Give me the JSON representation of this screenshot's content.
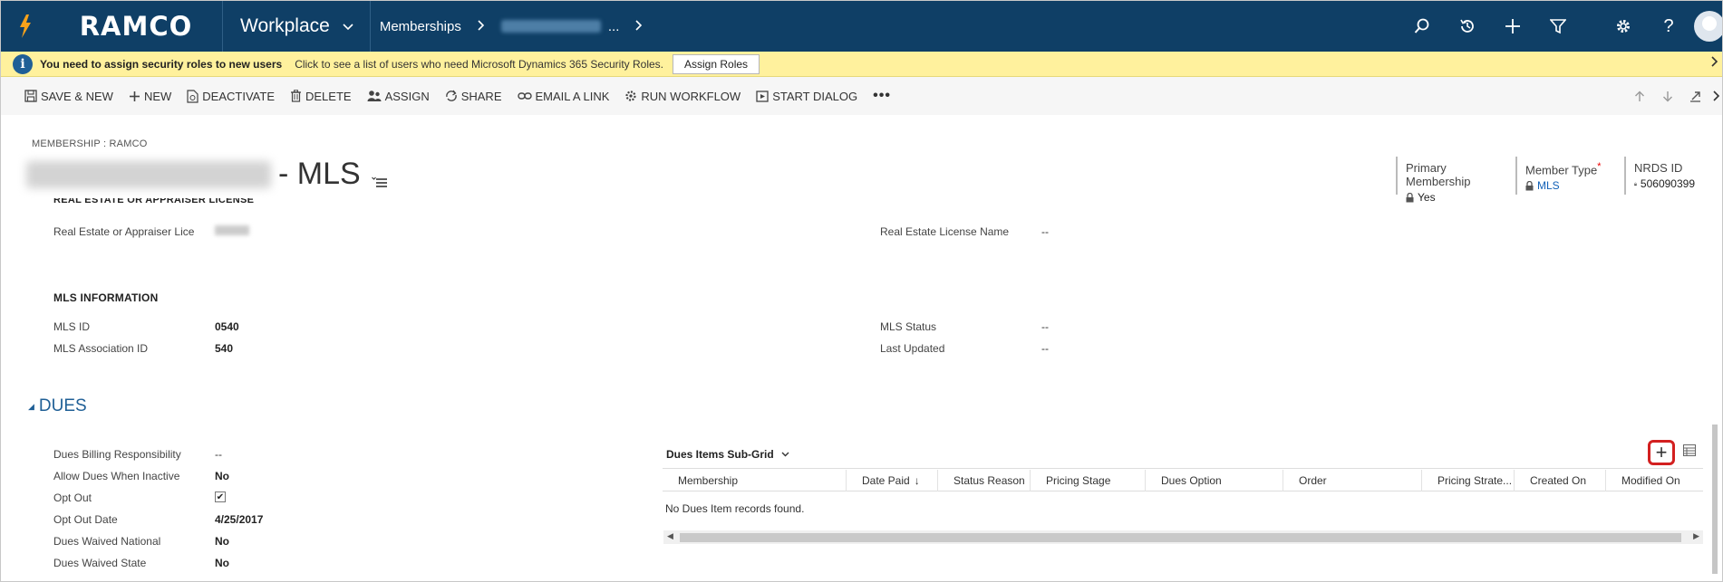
{
  "nav": {
    "logo_text": "RAMCO",
    "workplace_label": "Workplace",
    "breadcrumb_entity": "Memberships",
    "breadcrumb_more": "...",
    "icons": [
      "search-icon",
      "history-icon",
      "plus-icon",
      "filter-icon",
      "gear-icon",
      "help-icon",
      "avatar"
    ],
    "help_glyph": "?",
    "brand_color": "#0f3f66"
  },
  "notification": {
    "title": "You need to assign security roles to new users",
    "detail": "Click to see a list of users who need Microsoft Dynamics 365 Security Roles.",
    "button_label": "Assign Roles",
    "bg_color": "#fff19d"
  },
  "commands": [
    {
      "label": "SAVE & NEW",
      "icon": "save-icon"
    },
    {
      "label": "NEW",
      "icon": "plus-icon"
    },
    {
      "label": "DEACTIVATE",
      "icon": "document-icon"
    },
    {
      "label": "DELETE",
      "icon": "trash-icon"
    },
    {
      "label": "ASSIGN",
      "icon": "assign-icon"
    },
    {
      "label": "SHARE",
      "icon": "share-icon"
    },
    {
      "label": "EMAIL A LINK",
      "icon": "link-icon"
    },
    {
      "label": "RUN WORKFLOW",
      "icon": "workflow-icon"
    },
    {
      "label": "START DIALOG",
      "icon": "dialog-icon"
    }
  ],
  "record": {
    "entity_crumb": "MEMBERSHIP : RAMCO",
    "title_suffix": "- MLS",
    "header_fields": [
      {
        "label": "Primary Membership",
        "value": "Yes",
        "required": false,
        "link": false
      },
      {
        "label": "Member Type",
        "value": "MLS",
        "required": true,
        "link": true
      },
      {
        "label": "NRDS ID",
        "value": "506090399",
        "required": false,
        "link": false
      }
    ],
    "required_mark": "*"
  },
  "license": {
    "section_title_cut": "REAL ESTATE OR APPRAISER LICENSE",
    "appraiser_label": "Real Estate or Appraiser Lice",
    "license_name_label": "Real Estate License Name",
    "license_name_value": "--"
  },
  "mls": {
    "section_title": "MLS INFORMATION",
    "mls_id_label": "MLS ID",
    "mls_id_value": "0540",
    "assoc_id_label": "MLS Association ID",
    "assoc_id_value": "540",
    "status_label": "MLS Status",
    "status_value": "--",
    "updated_label": "Last Updated",
    "updated_value": "--"
  },
  "dues": {
    "section_title": "DUES",
    "fields": [
      {
        "label": "Dues Billing Responsibility",
        "value": "--",
        "type": "dash"
      },
      {
        "label": "Allow Dues When Inactive",
        "value": "No",
        "type": "bold"
      },
      {
        "label": "Opt Out",
        "value": "✔",
        "type": "checkbox"
      },
      {
        "label": "Opt Out Date",
        "value": "4/25/2017",
        "type": "bold"
      },
      {
        "label": "Dues Waived National",
        "value": "No",
        "type": "bold"
      },
      {
        "label": "Dues Waived State",
        "value": "No",
        "type": "bold"
      }
    ]
  },
  "subgrid": {
    "title": "Dues Items Sub-Grid",
    "add_glyph": "+",
    "columns": [
      "Membership",
      "Date Paid",
      "Status Reason",
      "Pricing Stage",
      "Dues Option",
      "Order",
      "Pricing Strate...",
      "Created On",
      "Modified On"
    ],
    "sort_glyph": "↓",
    "empty_message": "No Dues Item records found.",
    "highlight_color": "#d32020"
  }
}
